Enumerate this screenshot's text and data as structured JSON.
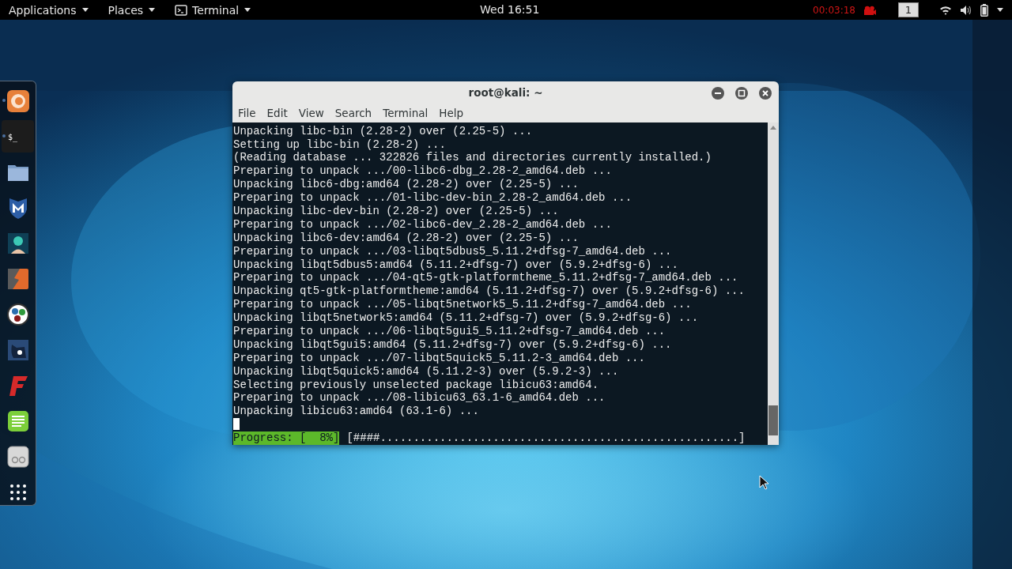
{
  "top_bar": {
    "menus": [
      {
        "label": "Applications",
        "kind": "plain"
      },
      {
        "label": "Places",
        "kind": "plain"
      },
      {
        "label": "Terminal",
        "kind": "app"
      }
    ],
    "clock": "Wed 16:51",
    "recording_time": "00:03:18",
    "workspace": "1"
  },
  "dock": {
    "items": [
      {
        "kind": "firefox",
        "running": true,
        "selected": false
      },
      {
        "kind": "terminal",
        "glyph": "$_",
        "running": true,
        "selected": true
      },
      {
        "kind": "folder",
        "running": false,
        "selected": false
      },
      {
        "kind": "shield",
        "running": false,
        "selected": false
      },
      {
        "kind": "figure",
        "running": false,
        "selected": false
      },
      {
        "kind": "bolt",
        "running": false,
        "selected": false
      },
      {
        "kind": "dots",
        "running": false,
        "selected": false
      },
      {
        "kind": "beast",
        "running": false,
        "selected": false
      },
      {
        "kind": "letter",
        "running": false,
        "selected": false
      },
      {
        "kind": "notes",
        "running": false,
        "selected": false
      },
      {
        "kind": "device",
        "running": false,
        "selected": false
      },
      {
        "kind": "grid",
        "running": false,
        "selected": false
      }
    ]
  },
  "window": {
    "title": "root@kali: ~",
    "menu": [
      "File",
      "Edit",
      "View",
      "Search",
      "Terminal",
      "Help"
    ],
    "lines": [
      "Unpacking libc-bin (2.28-2) over (2.25-5) ...",
      "Setting up libc-bin (2.28-2) ...",
      "(Reading database ... 322826 files and directories currently installed.)",
      "Preparing to unpack .../00-libc6-dbg_2.28-2_amd64.deb ...",
      "Unpacking libc6-dbg:amd64 (2.28-2) over (2.25-5) ...",
      "Preparing to unpack .../01-libc-dev-bin_2.28-2_amd64.deb ...",
      "Unpacking libc-dev-bin (2.28-2) over (2.25-5) ...",
      "Preparing to unpack .../02-libc6-dev_2.28-2_amd64.deb ...",
      "Unpacking libc6-dev:amd64 (2.28-2) over (2.25-5) ...",
      "Preparing to unpack .../03-libqt5dbus5_5.11.2+dfsg-7_amd64.deb ...",
      "Unpacking libqt5dbus5:amd64 (5.11.2+dfsg-7) over (5.9.2+dfsg-6) ...",
      "Preparing to unpack .../04-qt5-gtk-platformtheme_5.11.2+dfsg-7_amd64.deb ...",
      "Unpacking qt5-gtk-platformtheme:amd64 (5.11.2+dfsg-7) over (5.9.2+dfsg-6) ...",
      "Preparing to unpack .../05-libqt5network5_5.11.2+dfsg-7_amd64.deb ...",
      "Unpacking libqt5network5:amd64 (5.11.2+dfsg-7) over (5.9.2+dfsg-6) ...",
      "Preparing to unpack .../06-libqt5gui5_5.11.2+dfsg-7_amd64.deb ...",
      "Unpacking libqt5gui5:amd64 (5.11.2+dfsg-7) over (5.9.2+dfsg-6) ...",
      "Preparing to unpack .../07-libqt5quick5_5.11.2-3_amd64.deb ...",
      "Unpacking libqt5quick5:amd64 (5.11.2-3) over (5.9.2-3) ...",
      "Selecting previously unselected package libicu63:amd64.",
      "Preparing to unpack .../08-libicu63_63.1-6_amd64.deb ...",
      "Unpacking libicu63:amd64 (63.1-6) ..."
    ],
    "progress_label": "Progress: [  8%]",
    "progress_bar": "[####......................................................]"
  }
}
